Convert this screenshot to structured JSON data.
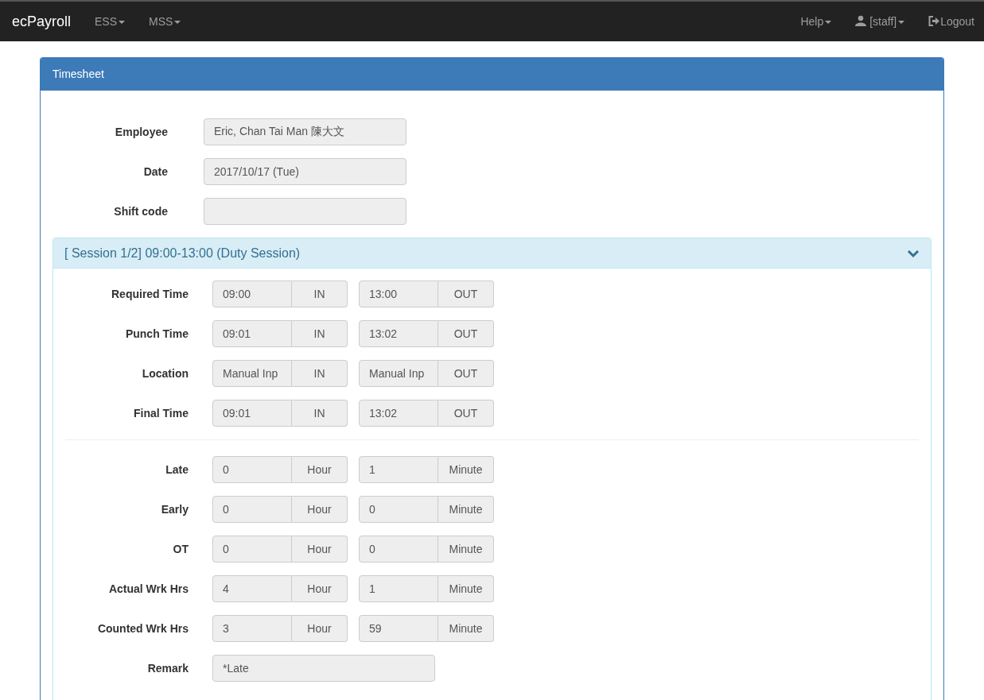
{
  "navbar": {
    "brand": "ecPayroll",
    "left_menus": [
      "ESS",
      "MSS"
    ],
    "right_menus": [
      {
        "kind": "menu",
        "label": "Help"
      },
      {
        "kind": "user",
        "label": "[staff]"
      },
      {
        "kind": "logout",
        "label": "Logout"
      }
    ]
  },
  "panel": {
    "title": "Timesheet",
    "fields": [
      {
        "label": "Employee",
        "value": "Eric, Chan Tai Man 陳大文"
      },
      {
        "label": "Date",
        "value": "2017/10/17 (Tue)"
      },
      {
        "label": "Shift code"
      }
    ],
    "session": {
      "title": "[ Session 1/2] 09:00-13:00 (Duty Session)",
      "expanded": true,
      "groups": [
        [
          {
            "kind": "pair",
            "label": "Required Time",
            "first": {
              "value": "09:00",
              "addon": "IN"
            },
            "second": {
              "value": "13:00",
              "addon": "OUT"
            }
          },
          {
            "kind": "pair",
            "label": "Punch Time",
            "first": {
              "value": "09:01",
              "addon": "IN"
            },
            "second": {
              "value": "13:02",
              "addon": "OUT"
            }
          },
          {
            "kind": "pair",
            "label": "Location",
            "first": {
              "value": "Manual Inp",
              "addon": "IN"
            },
            "second": {
              "value": "Manual Inp",
              "addon": "OUT"
            }
          },
          {
            "kind": "pair",
            "label": "Final Time",
            "first": {
              "value": "09:01",
              "addon": "IN"
            },
            "second": {
              "value": "13:02",
              "addon": "OUT"
            }
          }
        ],
        [
          {
            "kind": "pair",
            "label": "Late",
            "first": {
              "value": "0",
              "addon": "Hour"
            },
            "second": {
              "value": "1",
              "addon": "Minute"
            }
          },
          {
            "kind": "pair",
            "label": "Early",
            "first": {
              "value": "0",
              "addon": "Hour"
            },
            "second": {
              "value": "0",
              "addon": "Minute"
            }
          },
          {
            "kind": "pair",
            "label": "OT",
            "first": {
              "value": "0",
              "addon": "Hour"
            },
            "second": {
              "value": "0",
              "addon": "Minute"
            }
          },
          {
            "kind": "pair",
            "label": "Actual Wrk Hrs",
            "first": {
              "value": "4",
              "addon": "Hour"
            },
            "second": {
              "value": "1",
              "addon": "Minute"
            }
          },
          {
            "kind": "pair",
            "label": "Counted Wrk Hrs",
            "first": {
              "value": "3",
              "addon": "Hour"
            },
            "second": {
              "value": "59",
              "addon": "Minute"
            }
          },
          {
            "kind": "single",
            "label": "Remark",
            "value": "*Late"
          }
        ]
      ]
    }
  }
}
